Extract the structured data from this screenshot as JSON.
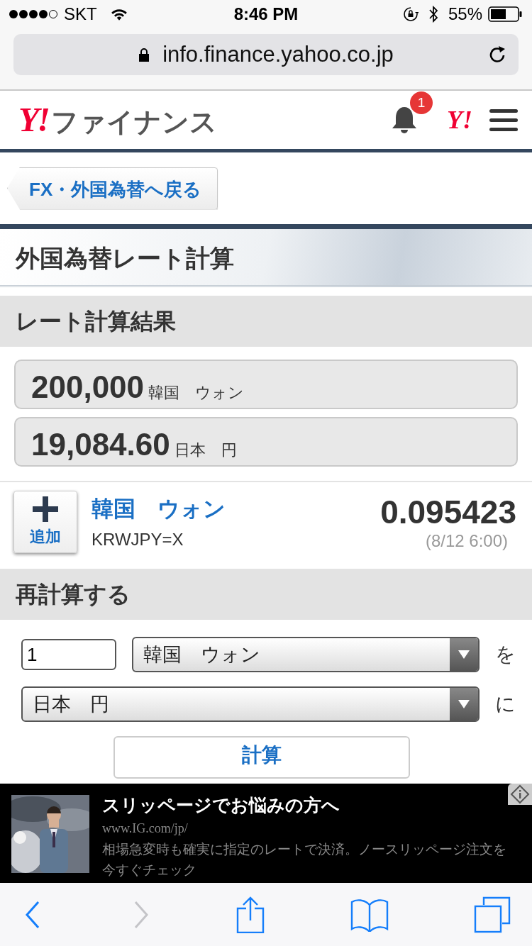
{
  "status_bar": {
    "carrier": "SKT",
    "time": "8:46 PM",
    "battery": "55%"
  },
  "address_bar": {
    "url": "info.finance.yahoo.co.jp"
  },
  "header": {
    "logo_mark": "Y!",
    "logo_text": "ファイナンス",
    "notification_count": "1",
    "yahoo_mark": "Y!"
  },
  "back_link": "FX・外国為替へ戻る",
  "page_title": "外国為替レート計算",
  "result_section": {
    "heading": "レート計算結果",
    "results": [
      {
        "amount": "200,000",
        "currency": "韓国　ウォン"
      },
      {
        "amount": "19,084.60",
        "currency": "日本　円"
      }
    ]
  },
  "rate": {
    "add_label": "追加",
    "currency_name": "韓国　ウォン",
    "symbol": "KRWJPY=X",
    "value": "0.095423",
    "time": "(8/12 6:00)"
  },
  "recalc_section": {
    "heading": "再計算する",
    "amount": "1",
    "from_currency": "韓国　ウォン",
    "from_suffix": "を",
    "to_currency": "日本　円",
    "to_suffix": "に",
    "button": "計算"
  },
  "ad": {
    "title": "スリッページでお悩みの方へ",
    "url": "www.IG.com/jp/",
    "body": "相場急変時も確実に指定のレートで決済。ノースリッページ注文を今すぐチェック"
  }
}
